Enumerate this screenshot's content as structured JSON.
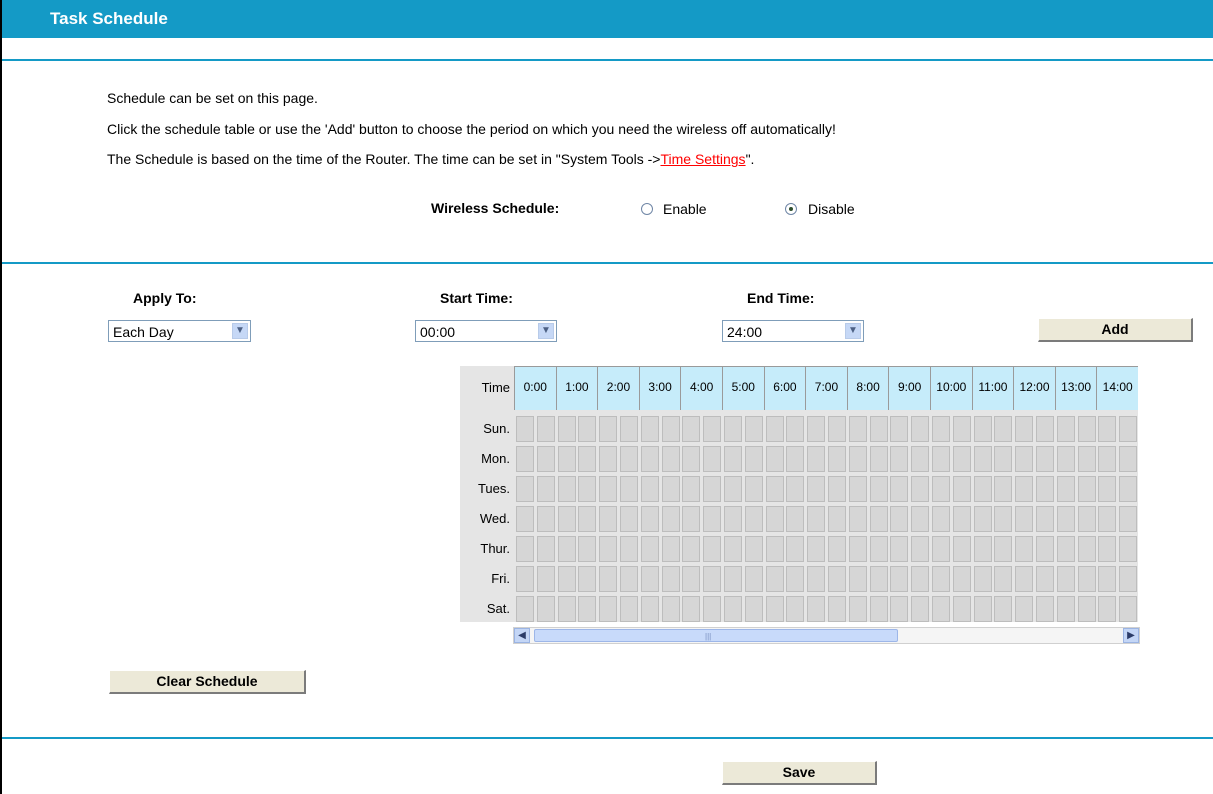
{
  "header": {
    "title": "Task Schedule"
  },
  "intro": {
    "line1": "Schedule can be set on this page.",
    "line2": "Click the schedule table or use the 'Add' button to choose the period on which you need the wireless off automatically!",
    "line3_prefix": "The Schedule is based on the time of the Router. The time can be set in \"System Tools ->",
    "line3_link": "Time Settings",
    "line3_suffix": "\"."
  },
  "wireless_schedule": {
    "label": "Wireless Schedule:",
    "options": [
      {
        "label": "Enable",
        "selected": false
      },
      {
        "label": "Disable",
        "selected": true
      }
    ]
  },
  "apply_to": {
    "label": "Apply To:",
    "value": "Each Day"
  },
  "start_time": {
    "label": "Start Time:",
    "value": "00:00"
  },
  "end_time": {
    "label": "End Time:",
    "value": "24:00"
  },
  "add_button": "Add",
  "schedule_table": {
    "time_header": "Time",
    "hours": [
      "0:00",
      "1:00",
      "2:00",
      "3:00",
      "4:00",
      "5:00",
      "6:00",
      "7:00",
      "8:00",
      "9:00",
      "10:00",
      "11:00",
      "12:00",
      "13:00",
      "14:00"
    ],
    "days": [
      "Sun.",
      "Mon.",
      "Tues.",
      "Wed.",
      "Thur.",
      "Fri.",
      "Sat."
    ]
  },
  "clear_button": "Clear Schedule",
  "save_button": "Save",
  "colors": {
    "accent": "#149ac6",
    "link": "#ff0000",
    "header_cell": "#c6ecfa",
    "cell": "#d6d6d6"
  }
}
